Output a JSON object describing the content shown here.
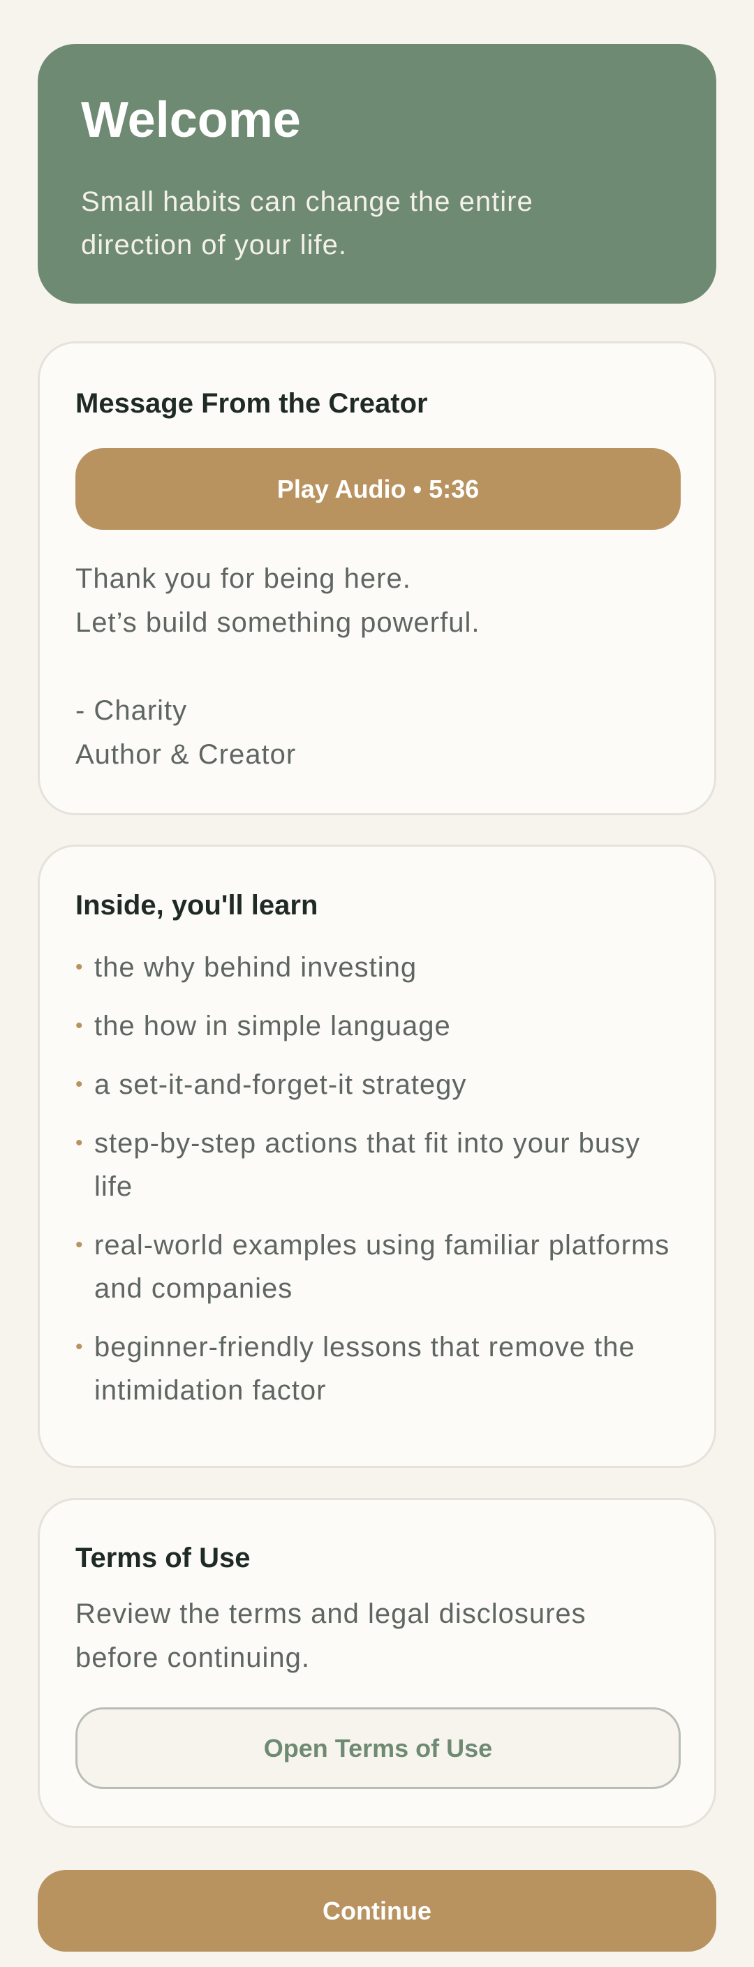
{
  "hero": {
    "title": "Welcome",
    "subtitle_line1": "Small habits can change the entire",
    "subtitle_line2": "direction of your life."
  },
  "creator_card": {
    "title": "Message From the Creator",
    "play_button_label": "Play Audio • 5:36",
    "message_line1": "Thank you for being here.",
    "message_line2": "Let’s build something powerful.",
    "signature_name": "- Charity",
    "signature_role": "Author & Creator"
  },
  "learn_card": {
    "title": "Inside, you'll learn",
    "items": [
      "the why behind investing",
      "the how in simple language",
      "a set-it-and-forget-it strategy",
      "step-by-step actions that fit into your busy life",
      "real-world examples using familiar platforms and companies",
      "beginner-friendly lessons that remove the intimidation factor"
    ]
  },
  "terms_card": {
    "title": "Terms of Use",
    "description_line1": "Review the terms and legal disclosures",
    "description_line2": "before continuing.",
    "button_label": "Open Terms of Use"
  },
  "footer": {
    "continue_label": "Continue"
  },
  "colors": {
    "background": "#f7f4ee",
    "hero_green": "#6e8a73",
    "accent_gold": "#b8925f",
    "card_background": "#fcfbf7",
    "title_text": "#1f2a24",
    "body_text": "#5f6661"
  },
  "icons": {
    "bullet": "bullet-dot-icon"
  }
}
